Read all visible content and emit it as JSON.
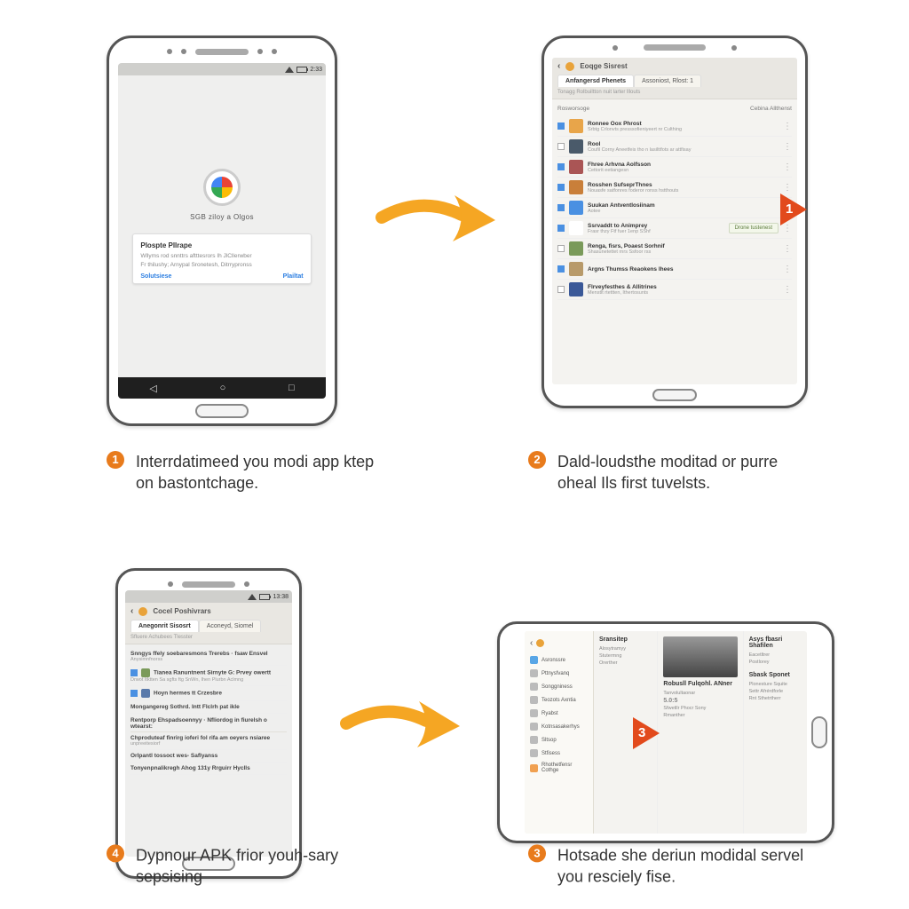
{
  "step1": {
    "statusbar_time": "2:33",
    "logo_title": "SGB ziloy a Olgos",
    "card_heading": "Plospte Pllrape",
    "card_line1": "Wllyms rod snnttrs aftttesrors Ih JlCllerwber",
    "card_line2": "Fr thilushy; Arnypal Sronetesh, Ditrrypronss",
    "card_action_left": "Solutsiese",
    "card_action_right": "Plailtat",
    "nav_back": "◁",
    "nav_home": "○",
    "nav_recent": "□",
    "caption_num": "1",
    "caption_text": "Interrdatimeed you modi app ktep on bastontchage."
  },
  "step2": {
    "header_title": "Eoqge Sisrest",
    "tab1": "Anfangersd Phenets",
    "tab2": "Assoniost, Rlost: 1",
    "header_desc": "Tonagg Rolbuiltton nuit larter lllouts",
    "filter_left": "Rosworsoge",
    "filter_right": "Cebina Allthenst",
    "rows": [
      {
        "title": "Ronnee Oox Phrost",
        "sub": "Srbtg Crlonvts presssofieniyeert nr Culthing",
        "icon": "#e8a54a",
        "cb": true
      },
      {
        "title": "Rool",
        "sub": "Coufil Corny Aneetfeis tho n lasilttfots ar attfisay",
        "icon": "#4a5a6a",
        "cb": false
      },
      {
        "title": "Fhree Arhvna Aolfsson",
        "sub": "Cettorit eetiangesn",
        "icon": "#a55",
        "cb": true
      },
      {
        "title": "Rosshen SufseprThnes",
        "sub": "Nouasfe satfonres foderor ronss hstthouts",
        "icon": "#c97f3a",
        "cb": true
      },
      {
        "title": "Suukan Antventlosiinam",
        "sub": "Aotee",
        "icon": "#4a90e2",
        "cb": true
      },
      {
        "title": "Ssrvaddt to Animprey",
        "sub": "Frasr thzy Ftf fuer 1enp SShf",
        "icon": "#fff",
        "cb": true,
        "btn": "Drone tustenest"
      },
      {
        "title": "Renga, fisrs, Poaest Sorhnif",
        "sub": "Shasunetettet rnrs Ssfoor rss",
        "icon": "#7a9a5a",
        "cb": false
      },
      {
        "title": "Argns Thumss Reaokens lhees",
        "sub": "",
        "icon": "#b89a6a",
        "cb": true
      },
      {
        "title": "Flrveyfesthes & Allitrines",
        "sub": "Menstlt rtettten, Ithertosunts",
        "icon": "#3b5998",
        "cb": false
      }
    ],
    "play_num": "1",
    "caption_num": "2",
    "caption_text": "Dald-loudsthe moditad or purre oheal Ils first tuvelsts."
  },
  "step3": {
    "statusbar_time": "13:38",
    "header_title": "Cocel Poshivrars",
    "tab1": "Anegonrit Sisosrt",
    "tab2": "Aconeyd, Siomel",
    "header_desc": "Sfluere Achubees Tlesster",
    "rows": [
      {
        "t": "Snngys ffely soebaresmons Trerebs · fsaw Ensvel",
        "s": "Anysimnfnorss"
      },
      {
        "t": "Tianea Ranuntnent Sirnyte G: Prvey owertt",
        "s": "Drwot Itktten Sa sgfts ftg SnWn, Ihen Plurbn Aclmng",
        "icon": "#7a9a5a",
        "cb": true
      },
      {
        "t": "Hoyn hermes tt Crzesbre",
        "s": "",
        "icon": "#5a7aaa",
        "cb": true
      },
      {
        "t": "Mongangereg Sothrd. Intt Flclrh pat ikle",
        "s": ""
      },
      {
        "sec": "Rentporp Ehspadsoennyy · Nfliordog in fiurelsh o wtearst:"
      },
      {
        "t": "Chproduteaf finrirg ioferi fol rifa am oeyers nsiaree",
        "s": "unpreeitesiorf"
      },
      {
        "t": "Orlpantl tossoct wes- Saflyanss",
        "s": ""
      },
      {
        "t": "Tonyenpnalikregh Ahog 131y Rrguirr Hyclls",
        "s": ""
      }
    ],
    "caption_num": "4",
    "caption_text": "Dypnour APK frior youh-sary sepsising"
  },
  "step4": {
    "side": [
      {
        "t": "Asronssre",
        "c": "b"
      },
      {
        "t": "Pttnysfvanq",
        "c": ""
      },
      {
        "t": "Songgniness",
        "c": ""
      },
      {
        "t": "Teozots Axntia",
        "c": ""
      },
      {
        "t": "Ryabst",
        "c": ""
      },
      {
        "t": "Kotnsasakerhys",
        "c": ""
      },
      {
        "t": "Sltsop",
        "c": ""
      },
      {
        "t": "Stfisess",
        "c": ""
      },
      {
        "t": "Rhothetfensr Cothge",
        "c": "o"
      }
    ],
    "col1_h": "Sransitep",
    "col1_lines": [
      "Alosytramyy",
      "Stutermng",
      "Orerther"
    ],
    "col2_h": "Robusll Fulqohl. ANner",
    "col2_sub": "Tanvolultaonar",
    "col2_price": "5.0:5",
    "col2_lines": [
      "Sfwetllr Phocr Sony",
      "Rmanther"
    ],
    "col3a_h": "Asys fbasri Shafilen",
    "col3a_lines": [
      "Eacetltrer",
      "Postlorey"
    ],
    "col3b_h": "Sbask Sponet",
    "col3b_lines": [
      "Plonesture Squite",
      "Settr Afrérdforle",
      "Rnt Sthetrtherr"
    ],
    "play_num": "3",
    "caption_num": "3",
    "caption_text": "Hotsade she deriun modidal servel you resciely fise."
  }
}
